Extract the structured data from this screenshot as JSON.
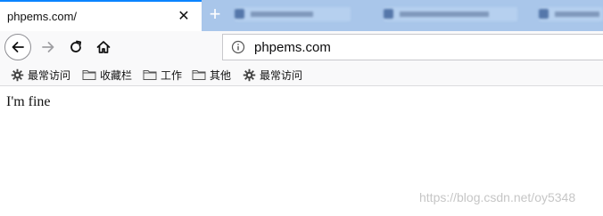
{
  "tabs": {
    "active_title": "phpems.com/",
    "close_symbol": "✕",
    "new_tab_symbol": "+",
    "background_tabs_blurred": true
  },
  "toolbar": {
    "back_icon": "arrow-left-icon",
    "forward_icon": "arrow-right-icon",
    "reload_icon": "reload-icon",
    "home_icon": "home-icon",
    "url": "phpems.com",
    "info_icon": "info-icon"
  },
  "bookmarks": [
    {
      "label": "最常访问",
      "icon": "gear-icon"
    },
    {
      "label": "收藏栏",
      "icon": "folder-icon"
    },
    {
      "label": "工作",
      "icon": "folder-icon"
    },
    {
      "label": "其他",
      "icon": "folder-icon"
    },
    {
      "label": "最常访问",
      "icon": "gear-icon"
    }
  ],
  "page": {
    "body_text": "I'm fine",
    "watermark": "https://blog.csdn.net/oy5348"
  },
  "colors": {
    "tabstrip": "#a9c6ea",
    "accent": "#0a84ff",
    "toolbar": "#f9f9fa"
  }
}
